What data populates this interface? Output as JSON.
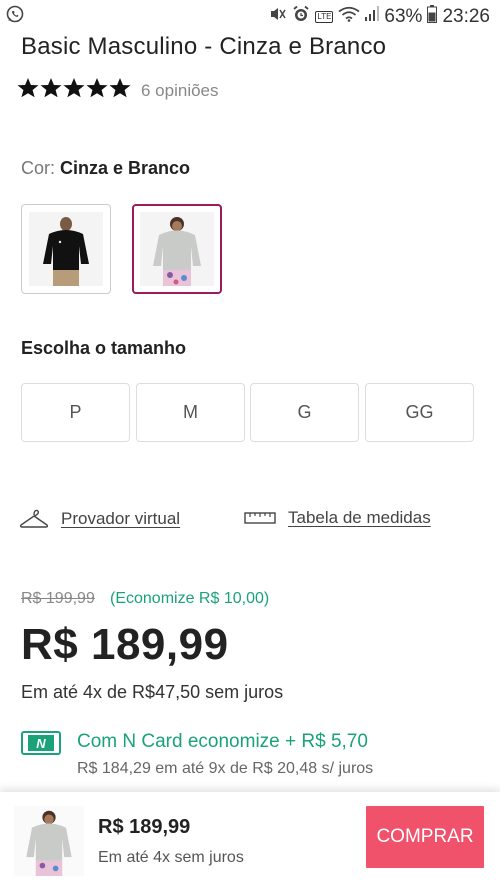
{
  "status_bar": {
    "battery": "63%",
    "time": "23:26",
    "network": "LTE",
    "icons": [
      "whatsapp-icon",
      "mute-icon",
      "alarm-icon",
      "volte-icon",
      "wifi-icon",
      "signal-icon",
      "battery-icon"
    ]
  },
  "product": {
    "title": "Basic Masculino - Cinza e Branco",
    "rating": 5,
    "reviews": "6 opiniões"
  },
  "color": {
    "label": "Cor: ",
    "selected": "Cinza e Branco",
    "swatches": [
      {
        "name": "black-hoodie",
        "selected": false
      },
      {
        "name": "gray-hoodie",
        "selected": true
      }
    ],
    "selected_border_color": "#9b1c5a"
  },
  "size": {
    "title": "Escolha o tamanho",
    "options": [
      "P",
      "M",
      "G",
      "GG"
    ]
  },
  "links": {
    "provador": "Provador virtual",
    "tabela": "Tabela de medidas"
  },
  "price": {
    "old": "R$ 199,99",
    "economize": "(Economize R$ 10,00)",
    "current": "R$ 189,99",
    "installments": "Em até 4x de R$47,50 sem juros",
    "ncard_logo": "N",
    "ncard_offer": "Com N Card economize + R$ 5,70",
    "ncard_detail": "R$ 184,29 em até 9x de R$ 20,48 s/ juros"
  },
  "bottom_bar": {
    "price": "R$ 189,99",
    "installments": "Em até 4x sem juros",
    "buy_label": "COMPRAR",
    "buy_color": "#f0526b"
  },
  "colors": {
    "accent_green": "#1aa37a",
    "accent_magenta": "#9b1c5a"
  }
}
